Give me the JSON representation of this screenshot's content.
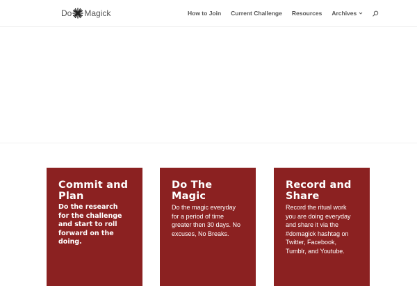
{
  "header": {
    "logo": {
      "left_text": "Do",
      "right_text": "Magick"
    },
    "nav": {
      "items": [
        {
          "label": "How to Join"
        },
        {
          "label": "Current Challenge"
        },
        {
          "label": "Resources"
        },
        {
          "label": "Archives"
        }
      ]
    },
    "icons": {
      "logo_mark": "asterisk-star-icon",
      "archives_dropdown": "chevron-down-icon",
      "search": "search-icon"
    }
  },
  "cards": [
    {
      "title": "Commit and Plan",
      "body": "Do the research for the challenge and start to roll forward on the doing."
    },
    {
      "title": "Do The Magic",
      "body": "Do the magic everyday for a period of time greater then 30 days. No excuses, No Breaks."
    },
    {
      "title": "Record and Share",
      "body": "Record the ritual work you are doing everyday and share it via the #domagick hashtag on Twitter, Facebook, Tumblr, and Youtube."
    }
  ],
  "colors": {
    "card_background": "#8b2121",
    "nav_text": "#555555",
    "card_text": "#ffffff"
  }
}
